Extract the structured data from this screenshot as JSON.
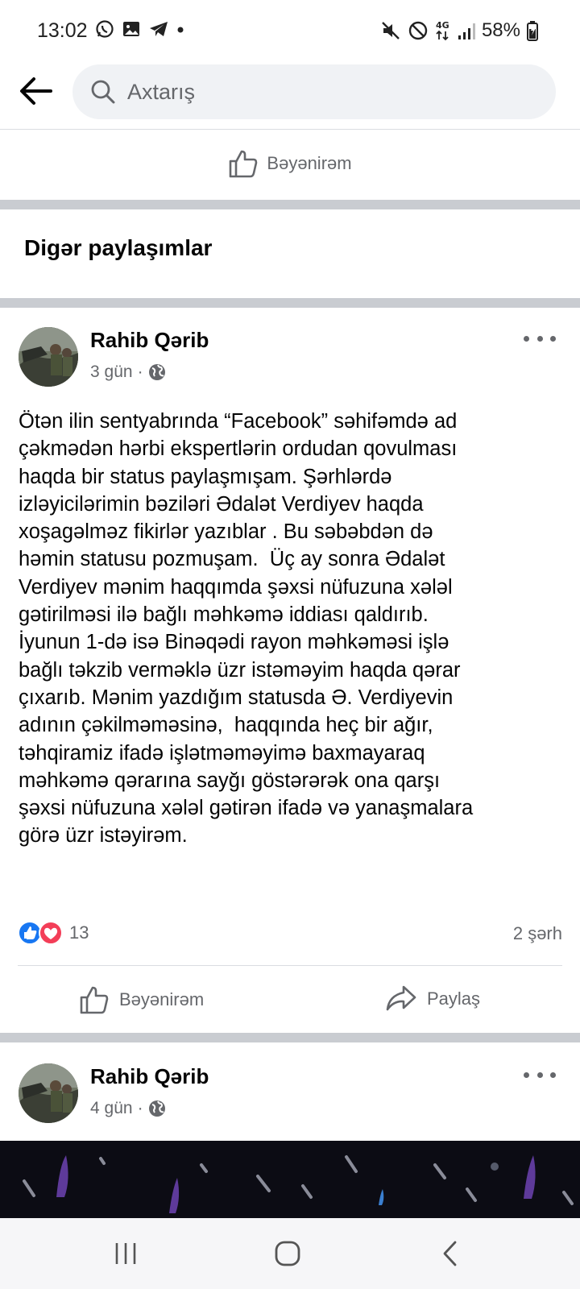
{
  "status_bar": {
    "time": "13:02",
    "left_icons": [
      "whatsapp-icon",
      "gallery-icon",
      "telegram-icon",
      "dot-icon"
    ],
    "right_icons": [
      "mute-icon",
      "do-not-disturb-icon",
      "4g-icon",
      "signal-icon"
    ],
    "network": "4G",
    "battery": "58%"
  },
  "header": {
    "search_placeholder": "Axtarış"
  },
  "previous_post": {
    "like_label": "Bəyənirəm"
  },
  "section": {
    "title": "Digər paylaşımlar"
  },
  "posts": [
    {
      "author": "Rahib Qərib",
      "time": "3 gün",
      "privacy_icon": "globe-icon",
      "text": "Ötən ilin sentyabrında “Facebook” səhifəmdə ad\nçəkmədən hərbi ekspertlərin ordudan qovulması\nhaqda bir status paylaşmışam. Şərhlərdə\nizləyicilərimin bəziləri Ədalət Verdiyev haqda\nxoşagəlməz fikirlər yazıblar . Bu səbəbdən də\nhəmin statusu pozmuşam.  Üç ay sonra Ədalət\nVerdiyev mənim haqqımda şəxsi nüfuzuna xələl\ngətirilməsi ilə bağlı məhkəmə iddiası qaldırıb.\nİyunun 1-də isə Binəqədi rayon məhkəməsi işlə\nbağlı təkzib verməklə üzr istəməyim haqda qərar\nçıxarıb. Mənim yazdığım statusda Ə. Verdiyevin\nadının çəkilməməsinə,  haqqında heç bir ağır,\ntəhqiramiz ifadə işlətməməyimə baxmayaraq\nməhkəmə qərarına sayğı göstərərək ona qarşı\nşəxsi nüfuzuna xələl gətirən ifadə və yanaşmalara\ngörə üzr istəyirəm.",
      "reaction_count": "13",
      "comments": "2 şərh",
      "like_label": "Bəyənirəm",
      "share_label": "Paylaş"
    },
    {
      "author": "Rahib Qərib",
      "time": "4 gün",
      "privacy_icon": "globe-icon"
    }
  ],
  "nav_bar": {
    "buttons": [
      "recent-apps-icon",
      "home-icon",
      "back-icon"
    ]
  },
  "colors": {
    "facebook_blue": "#1877f2",
    "love_red": "#f33e58",
    "secondary_text": "#65676b",
    "separator": "#c9ccd1"
  }
}
